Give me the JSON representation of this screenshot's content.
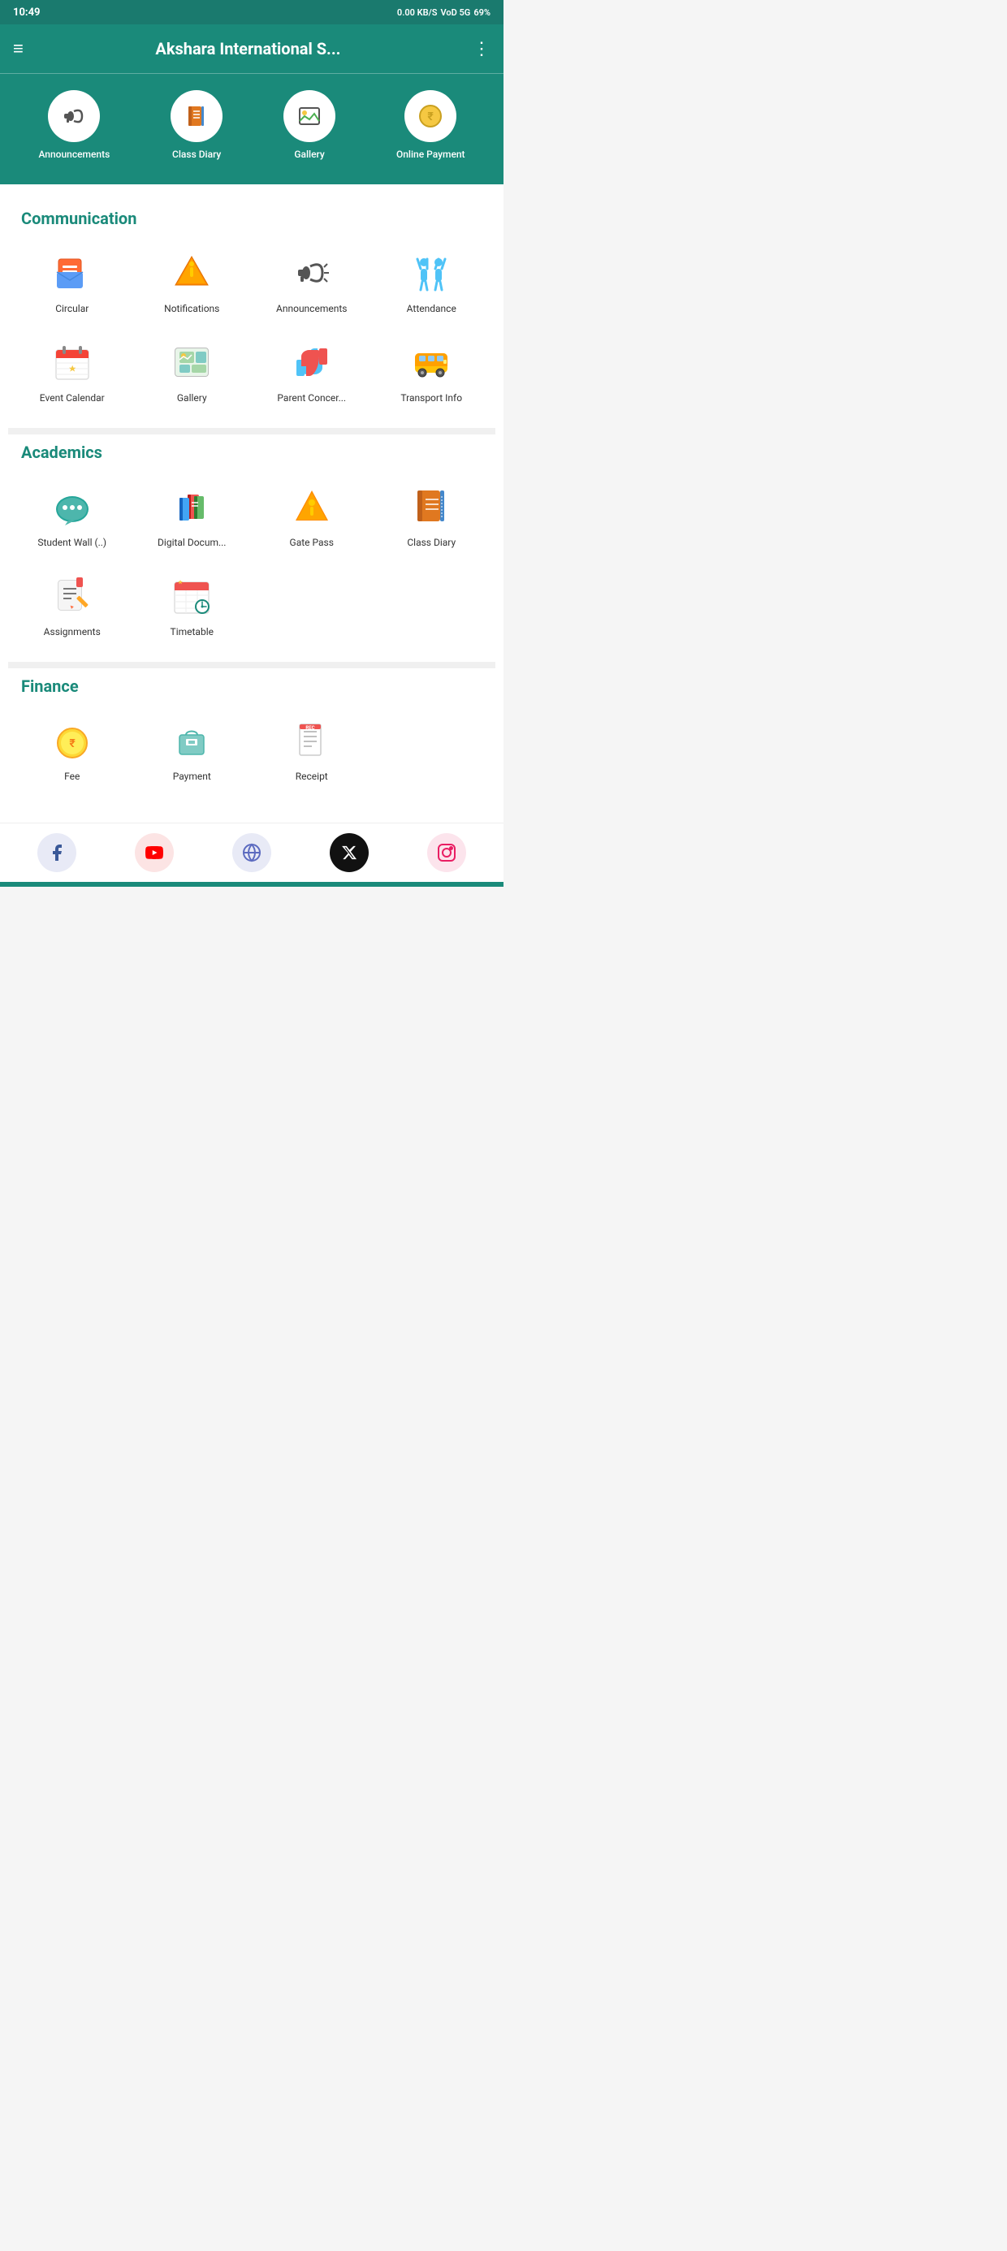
{
  "statusBar": {
    "time": "10:49",
    "network": "0.00 KB/S",
    "indicator": "VoD 5G",
    "battery": "69%"
  },
  "header": {
    "title": "Akshara International S...",
    "menuIcon": "≡",
    "dotsIcon": "⋮"
  },
  "topIcons": [
    {
      "id": "announcements",
      "label": "Announcements",
      "icon": "📢"
    },
    {
      "id": "class-diary",
      "label": "Class Diary",
      "icon": "📒"
    },
    {
      "id": "gallery",
      "label": "Gallery",
      "icon": "🖼️"
    },
    {
      "id": "online-payment",
      "label": "Online Payment",
      "icon": "💰"
    }
  ],
  "sections": [
    {
      "id": "communication",
      "title": "Communication",
      "items": [
        {
          "id": "circular",
          "label": "Circular",
          "icon": "envelope"
        },
        {
          "id": "notifications",
          "label": "Notifications",
          "icon": "star"
        },
        {
          "id": "announcements",
          "label": "Announcements",
          "icon": "megaphone"
        },
        {
          "id": "attendance",
          "label": "Attendance",
          "icon": "attendance"
        },
        {
          "id": "event-calendar",
          "label": "Event Calendar",
          "icon": "calendar"
        },
        {
          "id": "gallery",
          "label": "Gallery",
          "icon": "gallery"
        },
        {
          "id": "parent-concern",
          "label": "Parent Concer...",
          "icon": "parent-concern"
        },
        {
          "id": "transport-info",
          "label": "Transport Info",
          "icon": "bus"
        }
      ]
    },
    {
      "id": "academics",
      "title": "Academics",
      "items": [
        {
          "id": "student-wall",
          "label": "Student Wall (..)",
          "icon": "chat"
        },
        {
          "id": "digital-documents",
          "label": "Digital Docum...",
          "icon": "books"
        },
        {
          "id": "gate-pass",
          "label": "Gate Pass",
          "icon": "gate-pass"
        },
        {
          "id": "class-diary",
          "label": "Class Diary",
          "icon": "diary"
        },
        {
          "id": "assignments",
          "label": "Assignments",
          "icon": "assignments"
        },
        {
          "id": "timetable",
          "label": "Timetable",
          "icon": "timetable"
        }
      ]
    },
    {
      "id": "finance",
      "title": "Finance",
      "items": [
        {
          "id": "finance-1",
          "label": "Fee",
          "icon": "coin"
        },
        {
          "id": "finance-2",
          "label": "Payment",
          "icon": "payment"
        },
        {
          "id": "finance-3",
          "label": "Receipt",
          "icon": "receipt"
        }
      ]
    }
  ],
  "bottomNav": [
    {
      "id": "facebook",
      "label": "Facebook",
      "icon": "f",
      "class": "nav-facebook"
    },
    {
      "id": "youtube",
      "label": "YouTube",
      "icon": "▶",
      "class": "nav-youtube"
    },
    {
      "id": "globe",
      "label": "Website",
      "icon": "🌐",
      "class": "nav-globe"
    },
    {
      "id": "twitter-x",
      "label": "X (Twitter)",
      "icon": "✕",
      "class": "nav-x"
    },
    {
      "id": "instagram",
      "label": "Instagram",
      "icon": "📷",
      "class": "nav-instagram"
    }
  ]
}
